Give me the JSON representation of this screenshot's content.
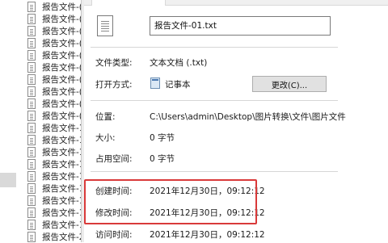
{
  "file_list": {
    "items": [
      "报告文件-(",
      "报告文件-(",
      "报告文件-(",
      "报告文件-(",
      "报告文件-(",
      "报告文件-(",
      "报告文件-(",
      "报告文件-(",
      "报告文件-(",
      "报告文件-(",
      "报告文件-1",
      "报告文件-1",
      "报告文件-1",
      "报告文件-1",
      "报告文件-1",
      "报告文件-1",
      "报告文件-1",
      "报告文件-1",
      "报告文件-1",
      "报告文件-2"
    ]
  },
  "properties": {
    "file_name": "报告文件-01.txt",
    "rows": {
      "file_type": {
        "label": "文件类型:",
        "value": "文本文档 (.txt)"
      },
      "open_with": {
        "label": "打开方式:",
        "value": "记事本",
        "button": "更改(C)..."
      },
      "location": {
        "label": "位置:",
        "value": "C:\\Users\\admin\\Desktop\\图片转换\\文件\\图片文件"
      },
      "size": {
        "label": "大小:",
        "value": "0 字节"
      },
      "size_on_disk": {
        "label": "占用空间:",
        "value": "0 字节"
      },
      "created": {
        "label": "创建时间:",
        "value": "2021年12月30日，09:12:12"
      },
      "modified": {
        "label": "修改时间:",
        "value": "2021年12月30日，09:12:12"
      },
      "accessed": {
        "label": "访问时间:",
        "value": "2021年12月30日，09:12:12"
      }
    }
  },
  "colors": {
    "highlight": "#d93a3a",
    "button_bg": "#e1e1e1"
  }
}
